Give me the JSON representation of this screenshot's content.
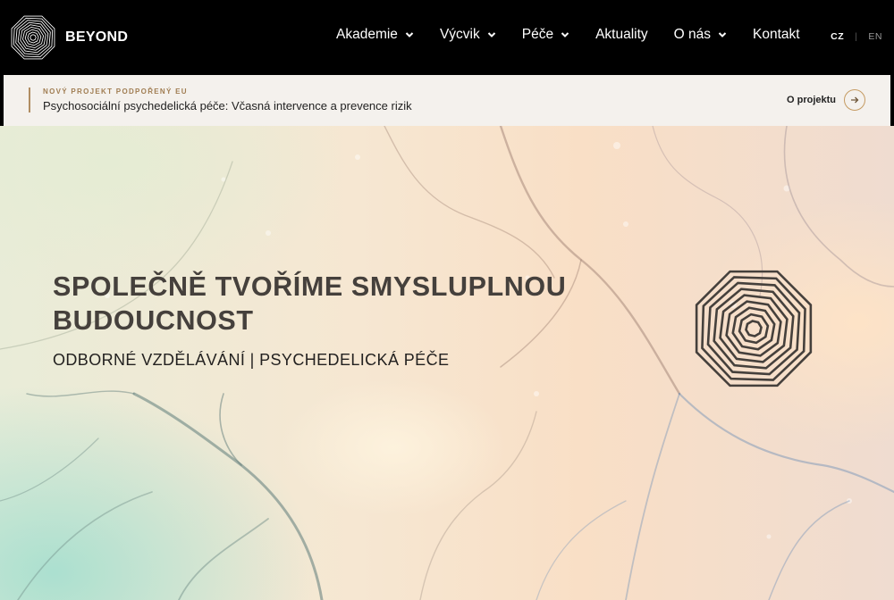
{
  "brand": {
    "name": "BEYOND",
    "logo_icon": "octagon-spiral-logo-icon"
  },
  "nav": {
    "items": [
      {
        "label": "Akademie",
        "has_dropdown": true
      },
      {
        "label": "Výcvik",
        "has_dropdown": true
      },
      {
        "label": "Péče",
        "has_dropdown": true
      },
      {
        "label": "Aktuality",
        "has_dropdown": false
      },
      {
        "label": "O nás",
        "has_dropdown": true
      },
      {
        "label": "Kontakt",
        "has_dropdown": false
      }
    ],
    "languages": {
      "active": "CZ",
      "separator": "|",
      "other": "EN"
    }
  },
  "announcement": {
    "kicker": "NOVÝ PROJEKT PODPOŘENÝ EU",
    "title": "Psychosociální psychedelická péče: Včasná intervence a prevence rizik",
    "cta_label": "O projektu",
    "cta_icon": "arrow-right-icon",
    "accent_color": "#b08d62"
  },
  "hero": {
    "headline": "SPOLEČNĚ TVOŘÍME SMYSLUPLNOU BUDOUCNOST",
    "subheadline": "ODBORNÉ VZDĚLÁVÁNÍ | PSYCHEDELICKÁ PÉČE",
    "mark_icon": "octagon-spiral-icon",
    "text_color": "#45403c"
  }
}
